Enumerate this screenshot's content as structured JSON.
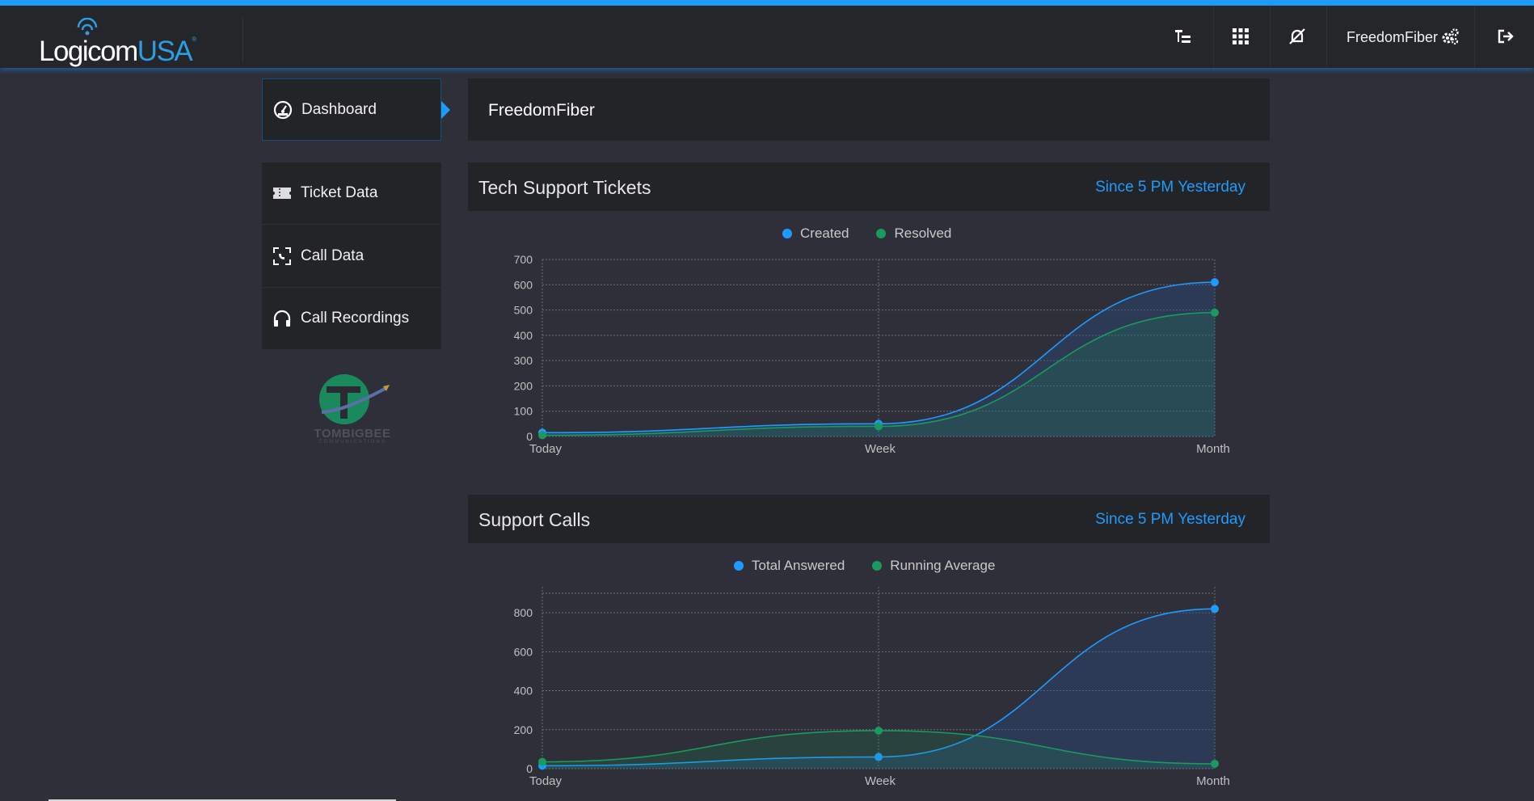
{
  "brand": {
    "logo_main": "Logicom",
    "logo_accent": "USA",
    "logo_mark": "®"
  },
  "header": {
    "user_name": "FreedomFiber",
    "icons": [
      "hierarchy-icon",
      "apps-grid-icon",
      "notifications-off-icon",
      "settings-gears-icon",
      "logout-icon"
    ]
  },
  "sidebar": {
    "items": [
      {
        "label": "Dashboard",
        "icon": "dashboard-icon",
        "active": true
      },
      {
        "label": "Ticket Data",
        "icon": "ticket-icon"
      },
      {
        "label": "Call Data",
        "icon": "call-data-icon"
      },
      {
        "label": "Call Recordings",
        "icon": "headphones-icon"
      }
    ],
    "partner_logo": {
      "name": "TOMBIGBEE",
      "sub": "COMMUNICATIONS"
    }
  },
  "page": {
    "title": "FreedomFiber"
  },
  "cards": [
    {
      "title": "Tech Support Tickets",
      "subtitle": "Since 5 PM Yesterday"
    },
    {
      "title": "Support Calls",
      "subtitle": "Since 5 PM Yesterday"
    }
  ],
  "colors": {
    "accent": "#1e9bff",
    "series_blue": "#1e9bff",
    "series_green": "#1a9a5f"
  },
  "chart_data": [
    {
      "type": "area",
      "categories": [
        "Today",
        "Week",
        "Month"
      ],
      "series": [
        {
          "name": "Created",
          "values": [
            15,
            50,
            610
          ]
        },
        {
          "name": "Resolved",
          "values": [
            5,
            40,
            490
          ]
        }
      ],
      "ylim": [
        0,
        700
      ],
      "yticks": [
        0,
        100,
        200,
        300,
        400,
        500,
        600,
        700
      ],
      "grid": true,
      "legend": "top-center"
    },
    {
      "type": "area",
      "categories": [
        "Today",
        "Week",
        "Month"
      ],
      "series": [
        {
          "name": "Total Answered",
          "values": [
            15,
            60,
            820
          ]
        },
        {
          "name": "Running Average",
          "values": [
            35,
            195,
            25
          ]
        }
      ],
      "ylim": [
        0,
        900
      ],
      "yticks": [
        0,
        200,
        400,
        600,
        800
      ],
      "grid": true,
      "legend": "top-center"
    }
  ]
}
